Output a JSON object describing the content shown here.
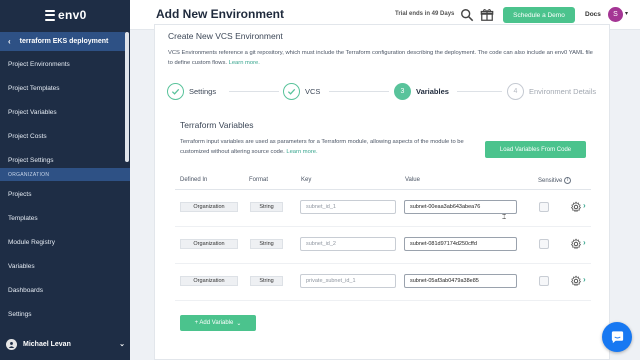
{
  "app": {
    "logo_text": "env0"
  },
  "sidebar": {
    "project_name": "terraform EKS deployment",
    "project_items": [
      {
        "label": "Project Environments"
      },
      {
        "label": "Project Templates"
      },
      {
        "label": "Project Variables"
      },
      {
        "label": "Project Costs"
      },
      {
        "label": "Project Settings"
      }
    ],
    "section_label": "ORGANIZATION",
    "org_items": [
      {
        "label": "Projects"
      },
      {
        "label": "Templates"
      },
      {
        "label": "Module Registry"
      },
      {
        "label": "Variables"
      },
      {
        "label": "Dashboards"
      },
      {
        "label": "Settings"
      }
    ],
    "user": {
      "name": "Michael Levan"
    }
  },
  "header": {
    "title": "Add New Environment",
    "trial_text": "Trial ends in 49 Days",
    "demo_button": "Schedule a Demo",
    "docs_label": "Docs",
    "avatar_initial": "S",
    "icons": [
      "search-icon",
      "gift-icon"
    ]
  },
  "card": {
    "title": "Create New VCS Environment",
    "description": "VCS Environments reference a git repository, which must include the Terraform configuration describing the deployment. The code can also include an env0 YAML file to define custom flows.",
    "learn_more": "Learn more."
  },
  "steps": [
    {
      "label": "Settings",
      "state": "done",
      "number": ""
    },
    {
      "label": "VCS",
      "state": "done",
      "number": ""
    },
    {
      "label": "Variables",
      "state": "active",
      "number": "3"
    },
    {
      "label": "Environment Details",
      "state": "todo",
      "number": "4"
    }
  ],
  "variables": {
    "title": "Terraform Variables",
    "description": "Terraform input variables are used as parameters for a Terraform module, allowing aspects of the module to be customized without altering source code.",
    "learn_more": "Learn more.",
    "load_button": "Load Variables From Code",
    "columns": [
      "Defined In",
      "Format",
      "Key",
      "Value",
      "Sensitive"
    ],
    "rows": [
      {
        "defined_in": "Organization",
        "format": "String",
        "key": "subnet_id_1",
        "value": "subnet-00eaa3ab643abea76",
        "sensitive": false
      },
      {
        "defined_in": "Organization",
        "format": "String",
        "key": "subnet_id_2",
        "value": "subnet-081d97174d250cffd",
        "sensitive": false
      },
      {
        "defined_in": "Organization",
        "format": "String",
        "key": "private_subnet_id_1",
        "value": "subnet-05af3ab0479a38e85",
        "sensitive": false
      }
    ],
    "add_button": "+ Add Variable"
  },
  "colors": {
    "sidebar_bg": "#1e2d45",
    "sidebar_active": "#2e5185",
    "accent_green": "#4bc38d",
    "chat_blue": "#1778f2",
    "avatar": "#a43594"
  }
}
